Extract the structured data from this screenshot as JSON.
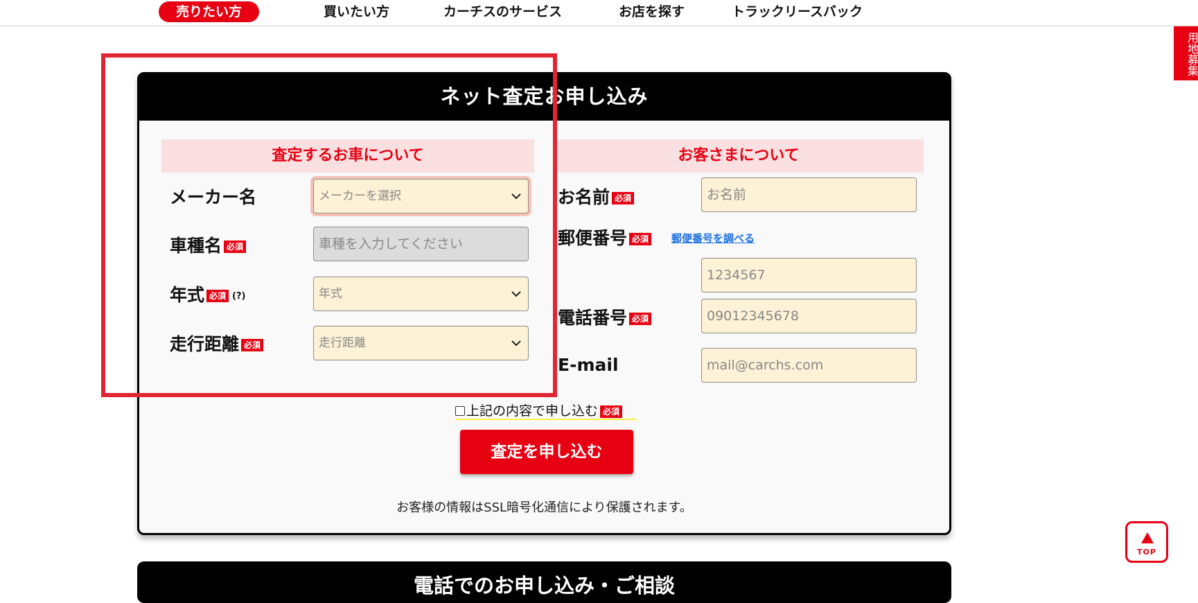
{
  "nav": {
    "items": [
      "売りたい方",
      "買いたい方",
      "カーチスのサービス",
      "お店を探す",
      "トラックリースバック"
    ]
  },
  "side_tab": "用地募集",
  "form": {
    "title": "ネット査定お申し込み",
    "required_badge": "必須",
    "car_section": {
      "heading": "査定するお車について",
      "maker_label": "メーカー名",
      "maker_placeholder": "メーカーを選択",
      "model_label": "車種名",
      "model_placeholder": "車種を入力してください",
      "year_label": "年式",
      "year_hint": "(?)",
      "year_placeholder": "年式",
      "mileage_label": "走行距離",
      "mileage_placeholder": "走行距離"
    },
    "customer_section": {
      "heading": "お客さまについて",
      "name_label": "お名前",
      "name_placeholder": "お名前",
      "zip_label": "郵便番号",
      "zip_link": "郵便番号を調べる",
      "zip_placeholder": "1234567",
      "phone_label": "電話番号",
      "phone_placeholder": "09012345678",
      "email_label": "E-mail",
      "email_placeholder": "mail@carchs.com"
    },
    "agree_label": "上記の内容で申し込む",
    "submit_label": "査定を申し込む",
    "ssl_note": "お客様の情報はSSL暗号化通信により保護されます。"
  },
  "second_card_title": "電話でのお申し込み・ご相談",
  "top_button": "TOP",
  "colors": {
    "accent": "#e60012",
    "field_bg": "#fdf1d6",
    "section_bg": "#fae0e0"
  }
}
